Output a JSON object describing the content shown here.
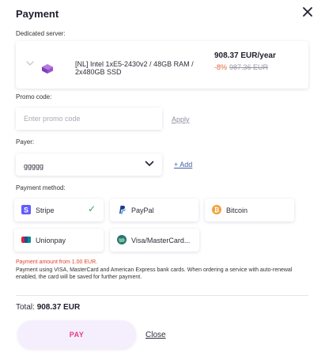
{
  "dialog": {
    "title": "Payment",
    "close_icon": "close-icon"
  },
  "server": {
    "section_label": "Dedicated server:",
    "name": "[NL] Intel 1xE5-2430v2 / 48GB RAM / 2x480GB SSD",
    "price": "908.37 EUR/year",
    "discount": "-8%",
    "old_price": "987.36 EUR",
    "expand_icon": "chevron-down-icon",
    "server_icon": "server-icon"
  },
  "promo": {
    "label": "Promo code:",
    "placeholder": "Enter promo code",
    "value": "",
    "apply_label": "Apply"
  },
  "payer": {
    "label": "Payer:",
    "value": "ggggg",
    "add_label": "+ Add"
  },
  "payment_method": {
    "label": "Payment method:",
    "options": [
      {
        "label": "Stripe",
        "icon": "stripe-icon",
        "selected": true
      },
      {
        "label": "PayPal",
        "icon": "paypal-icon",
        "selected": false
      },
      {
        "label": "Bitcoin",
        "icon": "bitcoin-icon",
        "selected": false
      },
      {
        "label": "Unionpay",
        "icon": "unionpay-icon",
        "selected": false
      },
      {
        "label": "Visa/MasterCard...",
        "icon": "globe-card-icon",
        "selected": false
      }
    ],
    "check_glyph": "✓"
  },
  "messages": {
    "warning": "Payment amount from 1.00 EUR.",
    "note": "Payment using VISA, MasterCard and American Express bank cards. When ordering a service with auto-renewal enabled, the card will be saved for further payment."
  },
  "total": {
    "label": "Total:",
    "value": "908.37 EUR"
  },
  "actions": {
    "pay_label": "PAY",
    "close_label": "Close"
  },
  "colors": {
    "accent_pink": "#e23a8a",
    "discount_orange": "#e2673a",
    "warning_red": "#e0412f",
    "link_blue": "#4a5fa8",
    "check_green": "#3aa35e"
  }
}
